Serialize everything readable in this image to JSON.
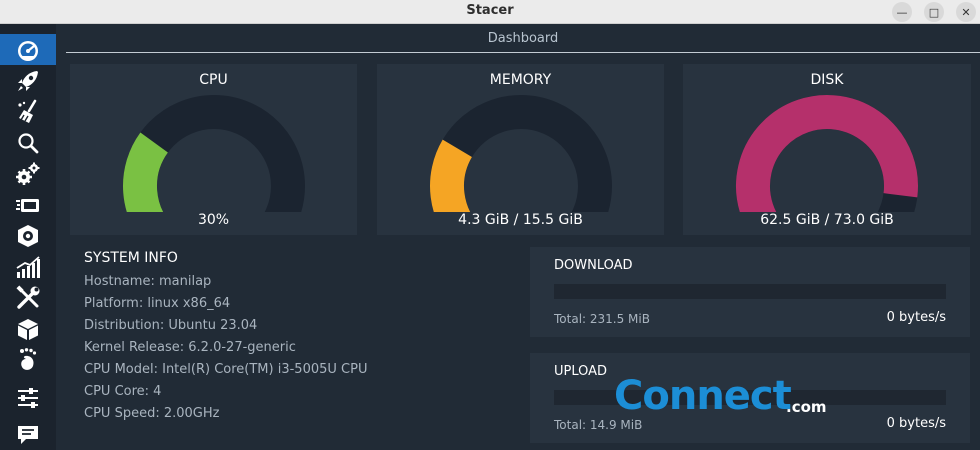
{
  "window": {
    "title": "Stacer",
    "minimize_glyph": "—",
    "maximize_glyph": "□",
    "close_glyph": "✕"
  },
  "sidebar": {
    "items": [
      {
        "icon": "dashboard-icon",
        "active": true
      },
      {
        "icon": "rocket-icon",
        "active": false
      },
      {
        "icon": "broom-icon",
        "active": false
      },
      {
        "icon": "search-icon",
        "active": false
      },
      {
        "icon": "gears-icon",
        "active": false
      },
      {
        "icon": "processes-icon",
        "active": false
      },
      {
        "icon": "uninstaller-icon",
        "active": false
      },
      {
        "icon": "resources-chart-icon",
        "active": false
      },
      {
        "icon": "helpers-tools-icon",
        "active": false
      },
      {
        "icon": "package-box-icon",
        "active": false
      },
      {
        "icon": "gnome-foot-icon",
        "active": false
      },
      {
        "icon": "settings-sliders-icon",
        "active": false
      },
      {
        "icon": "feedback-chat-icon",
        "active": false
      }
    ]
  },
  "dashboard": {
    "title": "Dashboard",
    "gauges": [
      {
        "label": "CPU",
        "value_text": "30%",
        "fraction": 0.3,
        "color": "#7ac143"
      },
      {
        "label": "MEMORY",
        "value_text": "4.3 GiB / 15.5 GiB",
        "fraction": 0.28,
        "color": "#f5a524"
      },
      {
        "label": "DISK",
        "value_text": "62.5 GiB / 73.0 GiB",
        "fraction": 0.86,
        "color": "#b5306b"
      }
    ],
    "track_color": "#1b2430",
    "system_info": {
      "heading": "SYSTEM INFO",
      "rows": [
        "Hostname: manilap",
        "Platform: linux x86_64",
        "Distribution: Ubuntu 23.04",
        "Kernel Release: 6.2.0-27-generic",
        "CPU Model: Intel(R) Core(TM) i3-5005U CPU",
        "CPU Core: 4",
        "CPU Speed: 2.00GHz"
      ]
    },
    "download": {
      "title": "DOWNLOAD",
      "total": "Total: 231.5 MiB",
      "rate": "0 bytes/s"
    },
    "upload": {
      "title": "UPLOAD",
      "total": "Total: 14.9 MiB",
      "rate": "0 bytes/s"
    }
  },
  "watermark": {
    "word": "Connect",
    "suffix": ".com"
  }
}
